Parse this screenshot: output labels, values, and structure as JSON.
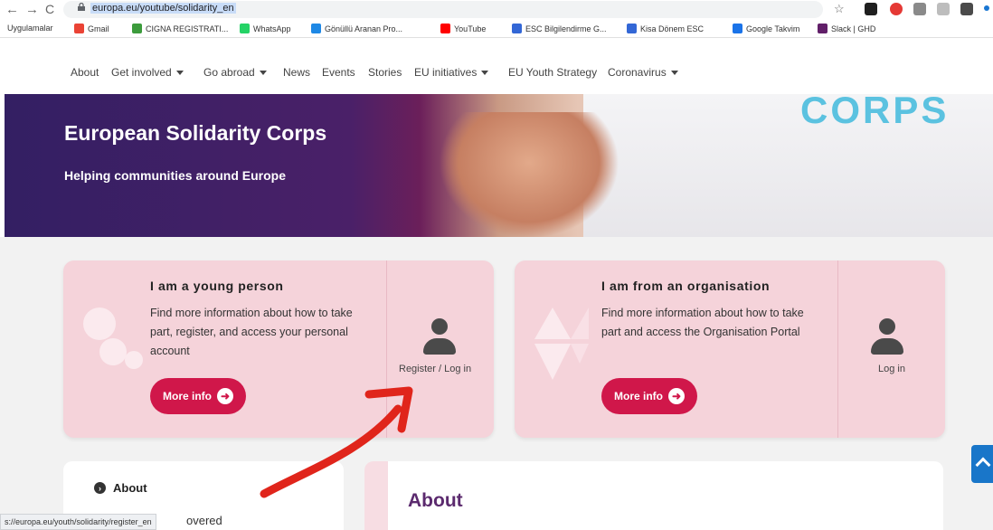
{
  "browser": {
    "back": "←",
    "forward": "→",
    "reload": "C",
    "url": "europa.eu/youtube/solidarity_en",
    "bookmarks": [
      {
        "label": "Uygulamalar",
        "color": "#5f6368"
      },
      {
        "label": "Gmail",
        "color": "#ea4335"
      },
      {
        "label": "CIGNA REGISTRATI...",
        "color": "#3c9b3c"
      },
      {
        "label": "WhatsApp",
        "color": "#25d366"
      },
      {
        "label": "Gönüllü Aranan Pro...",
        "color": "#1e88e5"
      },
      {
        "label": "YouTube",
        "color": "#ff0000"
      },
      {
        "label": "ESC Bilgilendirme G...",
        "color": "#3367d6"
      },
      {
        "label": "Kisa Dönem ESC",
        "color": "#3367d6"
      },
      {
        "label": "Google Takvim",
        "color": "#1a73e8"
      },
      {
        "label": "Slack | GHD",
        "color": "#611f69"
      }
    ],
    "status_url": "s://europa.eu/youth/solidarity/register_en"
  },
  "site_nav": {
    "items": [
      {
        "label": "About",
        "dropdown": false
      },
      {
        "label": "Get involved",
        "dropdown": true
      },
      {
        "label": "Go abroad",
        "dropdown": true
      },
      {
        "label": "News",
        "dropdown": false
      },
      {
        "label": "Events",
        "dropdown": false
      },
      {
        "label": "Stories",
        "dropdown": false
      },
      {
        "label": "EU initiatives",
        "dropdown": true
      },
      {
        "label": "EU Youth Strategy",
        "dropdown": false
      },
      {
        "label": "Coronavirus",
        "dropdown": true
      }
    ]
  },
  "hero": {
    "title": "European Solidarity Corps",
    "subtitle": "Helping communities around Europe",
    "shirt_text": "CORPS"
  },
  "cards": [
    {
      "title": "I am a young person",
      "description": "Find more information about how to take part, register, and access your personal account",
      "button": "More info",
      "login_label": "Register / Log in"
    },
    {
      "title": "I am from an organisation",
      "description": "Find more information about how to take part and access the Organisation Portal",
      "button": "More info",
      "login_label": "Log in"
    }
  ],
  "sidebar": {
    "link": "About",
    "cut_text": "overed"
  },
  "main": {
    "heading": "About"
  },
  "colors": {
    "accent": "#d0174a",
    "card_bg": "#f5d3da",
    "heading_purple": "#5b2a6e",
    "annotation_red": "#e0251b"
  }
}
